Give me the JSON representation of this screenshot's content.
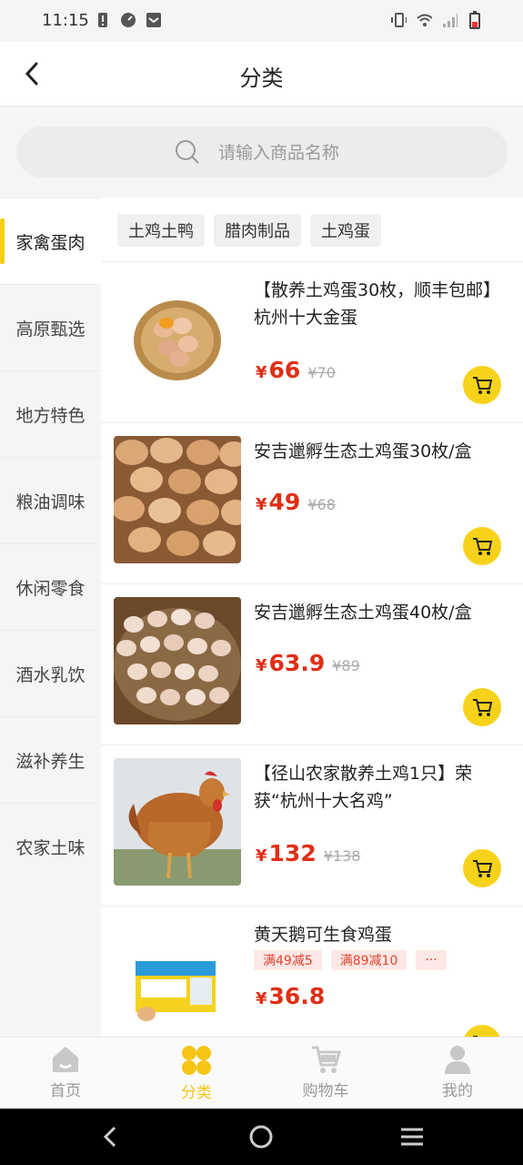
{
  "status": {
    "time": "11:15"
  },
  "header": {
    "title": "分类"
  },
  "search": {
    "placeholder": "请输入商品名称"
  },
  "sidebar": {
    "items": [
      {
        "label": "家禽蛋肉",
        "active": true
      },
      {
        "label": "高原甄选"
      },
      {
        "label": "地方特色"
      },
      {
        "label": "粮油调味"
      },
      {
        "label": "休闲零食"
      },
      {
        "label": "酒水乳饮"
      },
      {
        "label": "滋补养生"
      },
      {
        "label": "农家土味"
      }
    ]
  },
  "tags": [
    "土鸡土鸭",
    "腊肉制品",
    "土鸡蛋"
  ],
  "products": [
    {
      "name": "【散养土鸡蛋30枚，顺丰包邮】杭州十大金蛋",
      "price": "66",
      "old_price": "¥70",
      "currency": "¥"
    },
    {
      "name": "安吉邋孵生态土鸡蛋30枚/盒",
      "price": "49",
      "old_price": "¥68",
      "currency": "¥"
    },
    {
      "name": "安吉邋孵生态土鸡蛋40枚/盒",
      "price": "63.9",
      "old_price": "¥89",
      "currency": "¥"
    },
    {
      "name": "【径山农家散养土鸡1只】荣获“杭州十大名鸡”",
      "price": "132",
      "old_price": "¥138",
      "currency": "¥"
    },
    {
      "name": "黄天鹅可生食鸡蛋",
      "price": "36.8",
      "old_price": "",
      "currency": "¥",
      "promos": [
        "满49减5",
        "满89减10",
        "···"
      ]
    }
  ],
  "tabbar": {
    "tabs": [
      {
        "label": "首页",
        "icon": "home-icon"
      },
      {
        "label": "分类",
        "icon": "category-icon",
        "active": true
      },
      {
        "label": "购物车",
        "icon": "cart-icon"
      },
      {
        "label": "我的",
        "icon": "profile-icon"
      }
    ]
  },
  "colors": {
    "accent": "#f5c518",
    "price": "#e02e16",
    "cart_button": "#f7d21b"
  }
}
